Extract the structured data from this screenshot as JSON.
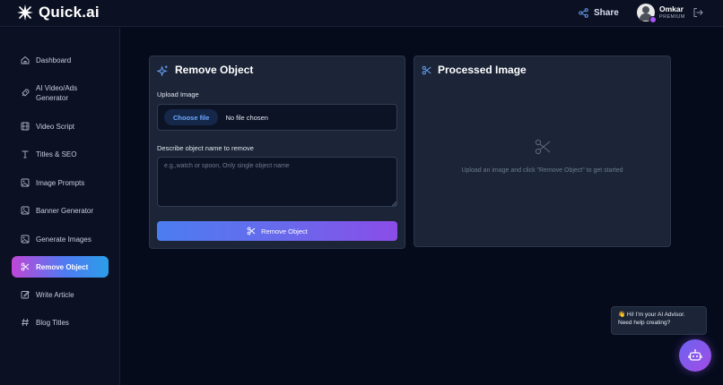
{
  "app": {
    "name": "Quick.ai",
    "share_label": "Share",
    "user_name": "Omkar",
    "user_plan": "PREMIUM"
  },
  "sidebar": {
    "items": [
      {
        "label": "Dashboard",
        "icon": "home-icon"
      },
      {
        "label": "AI Video/Ads Generator",
        "icon": "rocket-icon"
      },
      {
        "label": "Video Script",
        "icon": "film-icon"
      },
      {
        "label": "Titles & SEO",
        "icon": "type-icon"
      },
      {
        "label": "Image Prompts",
        "icon": "image-icon"
      },
      {
        "label": "Banner Generator",
        "icon": "image-icon"
      },
      {
        "label": "Generate Images",
        "icon": "image-icon"
      },
      {
        "label": "Remove Object",
        "icon": "scissors-icon",
        "active": true
      },
      {
        "label": "Write Article",
        "icon": "edit-icon"
      },
      {
        "label": "Blog Titles",
        "icon": "hash-icon"
      }
    ]
  },
  "remove_card": {
    "title": "Remove Object",
    "upload_label": "Upload Image",
    "choose_file_label": "Choose file",
    "file_status": "No file chosen",
    "describe_label": "Describe object name to remove",
    "describe_placeholder": "e.g.,watch or spoon, Only single object name",
    "describe_value": "",
    "submit_label": "Remove Object"
  },
  "processed_card": {
    "title": "Processed Image",
    "empty_text": "Upload an image and click \"Remove Object\" to get started"
  },
  "advisor": {
    "greeting": "👋 Hi! I'm your AI Advisor.",
    "prompt": "Need help creating?"
  },
  "colors": {
    "background": "#060b1c",
    "panel": "#1b2537",
    "accent_blue": "#4c7df0",
    "accent_purple": "#8b4de8"
  }
}
